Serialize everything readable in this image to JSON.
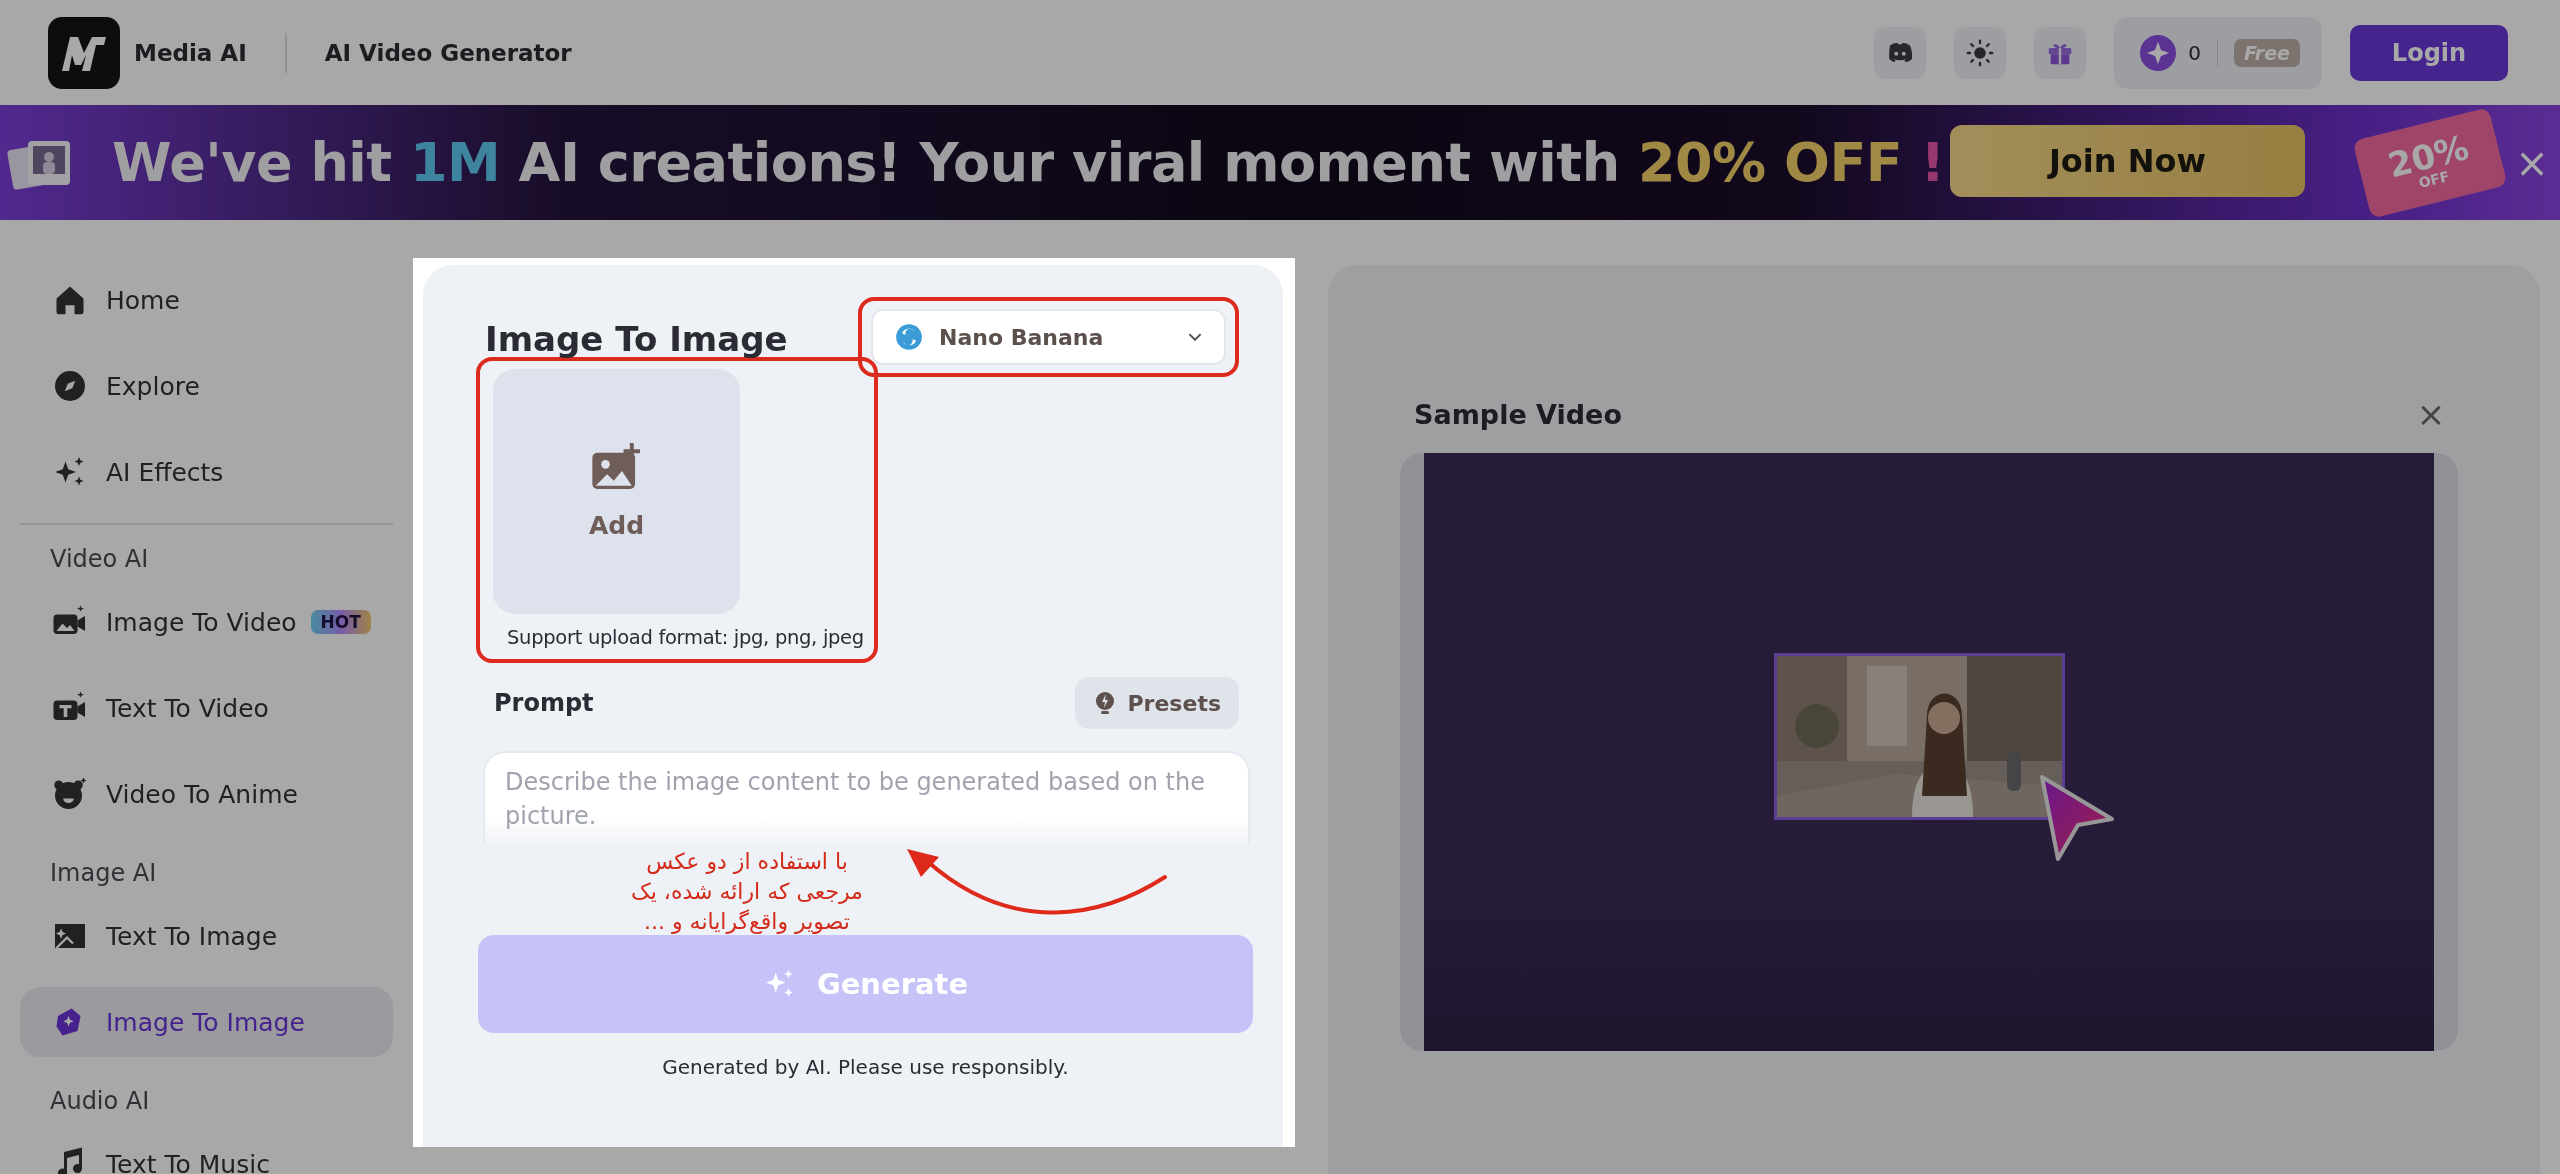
{
  "header": {
    "brand": "Media AI",
    "product": "AI Video Generator",
    "credits": "0",
    "plan": "Free",
    "login": "Login"
  },
  "banner": {
    "headline": [
      {
        "text": "We've hit ",
        "kind": "plain"
      },
      {
        "text": "1M",
        "kind": "blue"
      },
      {
        "text": " AI creations! Your viral moment with ",
        "kind": "plain"
      },
      {
        "text": "20% OFF",
        "kind": "gold"
      },
      {
        "text": " !",
        "kind": "pink"
      }
    ],
    "button": "Join Now",
    "ticket": [
      "20%",
      "OFF"
    ],
    "close": "×"
  },
  "sidebar": {
    "items": [
      {
        "kind": "link",
        "label": "Home",
        "selected": false
      },
      {
        "kind": "link",
        "label": "Explore",
        "selected": false
      },
      {
        "kind": "link",
        "label": "AI Effects",
        "selected": false
      },
      {
        "kind": "divider"
      },
      {
        "kind": "section",
        "label": "Video AI"
      },
      {
        "kind": "link",
        "label": "Image To Video",
        "badge": "HOT",
        "selected": false
      },
      {
        "kind": "link",
        "label": "Text To Video",
        "selected": false
      },
      {
        "kind": "link",
        "label": "Video To Anime",
        "selected": false
      },
      {
        "kind": "section",
        "label": "Image AI"
      },
      {
        "kind": "link",
        "label": "Text To Image",
        "selected": false
      },
      {
        "kind": "link",
        "label": "Image To Image",
        "selected": true
      },
      {
        "kind": "section",
        "label": "Audio AI"
      },
      {
        "kind": "link",
        "label": "Text To Music",
        "selected": false
      }
    ]
  },
  "form": {
    "title": "Image To Image",
    "model": "Nano Banana",
    "upload_label": "Add",
    "upload_hint": "Support upload format: jpg, png, jpeg",
    "prompt_label": "Prompt",
    "presets": "Presets",
    "prompt_placeholder": "Describe the image content to be generated based on the picture.",
    "generate": "Generate",
    "disclaimer": "Generated by AI. Please use responsibly."
  },
  "annotation": {
    "lines": [
      "با استفاده از دو عکس",
      "مرجعی که ارائه شده، یک",
      "تصویر واقع‌گرایانه و ..."
    ]
  },
  "preview": {
    "title": "Sample Video",
    "close": "×"
  }
}
